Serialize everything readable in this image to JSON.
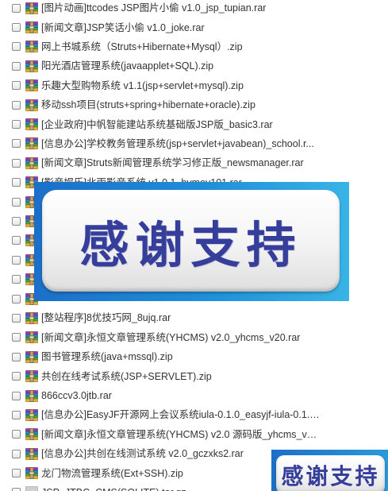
{
  "files": [
    {
      "icon": "winrar-archive-icon",
      "name": "[图片动画]ttcodes JSP图片小偷 v1.0_jsp_tupian.rar"
    },
    {
      "icon": "winrar-archive-icon",
      "name": "[新闻文章]JSP笑话小偷 v1.0_joke.rar"
    },
    {
      "icon": "winrar-archive-icon",
      "name": "网上书城系统（Struts+Hibernate+Mysql）.zip"
    },
    {
      "icon": "winrar-archive-icon",
      "name": "阳光酒店管理系统(javaapplet+SQL).zip"
    },
    {
      "icon": "winrar-archive-icon",
      "name": "乐趣大型购物系统 v1.1(jsp+servlet+mysql).zip"
    },
    {
      "icon": "winrar-archive-icon",
      "name": "移动ssh项目(struts+spring+hibernate+oracle).zip"
    },
    {
      "icon": "winrar-archive-icon",
      "name": "[企业政府]中帆智能建站系统基础版JSP版_basic3.rar"
    },
    {
      "icon": "winrar-archive-icon",
      "name": "[信息办公]学校教务管理系统(jsp+servlet+javabean)_school.r..."
    },
    {
      "icon": "winrar-archive-icon",
      "name": "[新闻文章]Struts新闻管理系统学习修正版_newsmanager.rar"
    },
    {
      "icon": "winrar-archive-icon",
      "name": "[影音娱乐]北雨影音系统 v1.0.1_bymov101.rar"
    },
    {
      "icon": "winrar-archive-icon",
      "name": ""
    },
    {
      "icon": "winrar-archive-icon",
      "name": ""
    },
    {
      "icon": "winrar-archive-icon",
      "name": ""
    },
    {
      "icon": "winrar-archive-icon",
      "name": ""
    },
    {
      "icon": "winrar-archive-icon",
      "name": ""
    },
    {
      "icon": "winrar-archive-icon",
      "name": ""
    },
    {
      "icon": "winrar-archive-icon",
      "name": "[整站程序]8优技巧网_8ujq.rar"
    },
    {
      "icon": "winrar-archive-icon",
      "name": "[新闻文章]永恒文章管理系统(YHCMS) v2.0_yhcms_v20.rar"
    },
    {
      "icon": "winrar-archive-icon",
      "name": "图书管理系统(java+mssql).zip"
    },
    {
      "icon": "winrar-archive-icon",
      "name": "共创在线考试系统(JSP+SERVLET).zip"
    },
    {
      "icon": "winrar-archive-icon",
      "name": "866ccv3.0jtb.rar"
    },
    {
      "icon": "winrar-archive-icon",
      "name": "[信息办公]EasyJF开源网上会议系统iula-0.1.0_easyjf-iula-0.1.0..."
    },
    {
      "icon": "winrar-archive-icon",
      "name": "[新闻文章]永恒文章管理系统(YHCMS) v2.0 源码版_yhcms_v20..."
    },
    {
      "icon": "winrar-archive-icon",
      "name": "[信息办公]共创在线测试系统 v2.0_gczxks2.rar"
    },
    {
      "icon": "winrar-archive-icon",
      "name": "龙门物流管理系统(Ext+SSH).zip"
    },
    {
      "icon": "generic-archive-icon",
      "name": "JSP_JTBC_CMS(SQLITE).tar.gz"
    }
  ],
  "banner": {
    "text": "感谢支持"
  },
  "banner_small": {
    "text": "感谢支持"
  },
  "colors": {
    "banner_blue": "#1f8fd8",
    "banner_text": "#353e9a",
    "file_text": "#333333"
  }
}
